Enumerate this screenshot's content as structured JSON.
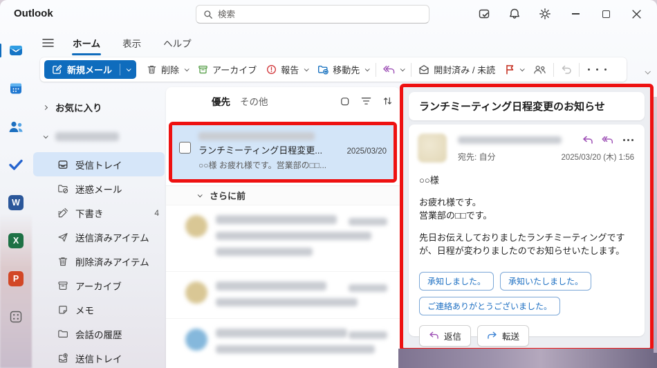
{
  "colors": {
    "accent": "#0f6cbd",
    "annotation_red": "#ee1111",
    "selected_mail_bg": "#d3e5f8",
    "folder_selected_bg": "#d6e6f9"
  },
  "titlebar": {
    "app_name": "Outlook",
    "search_placeholder": "検索"
  },
  "ribbon": {
    "tabs": [
      {
        "label": "ホーム"
      },
      {
        "label": "表示"
      },
      {
        "label": "ヘルプ"
      }
    ]
  },
  "toolbar": {
    "new_mail_label": "新規メール",
    "delete_label": "削除",
    "archive_label": "アーカイブ",
    "report_label": "報告",
    "move_to_label": "移動先",
    "read_unread_label": "開封済み / 未読"
  },
  "appbar": {
    "items": [
      {
        "name": "mail"
      },
      {
        "name": "calendar"
      },
      {
        "name": "people"
      },
      {
        "name": "todo"
      },
      {
        "name": "word",
        "letter": "W"
      },
      {
        "name": "excel",
        "letter": "X"
      },
      {
        "name": "powerpoint",
        "letter": "P"
      },
      {
        "name": "apps"
      }
    ]
  },
  "folder_pane": {
    "favorites_label": "お気に入り",
    "folders": [
      {
        "label": "受信トレイ",
        "icon": "inbox-icon",
        "selected": true
      },
      {
        "label": "迷惑メール",
        "icon": "junk-folder-icon"
      },
      {
        "label": "下書き",
        "icon": "drafts-pencil-icon",
        "count": "4"
      },
      {
        "label": "送信済みアイテム",
        "icon": "sent-plane-icon"
      },
      {
        "label": "削除済みアイテム",
        "icon": "trash-icon"
      },
      {
        "label": "アーカイブ",
        "icon": "archive-box-icon"
      },
      {
        "label": "メモ",
        "icon": "note-icon"
      },
      {
        "label": "会話の履歴",
        "icon": "folder-icon"
      },
      {
        "label": "送信トレイ",
        "icon": "outbox-icon"
      }
    ]
  },
  "message_list": {
    "tab_focused": "優先",
    "tab_other": "その他",
    "selected_email": {
      "subject": "ランチミーティング日程変更...",
      "date": "2025/03/20",
      "preview": "○○様 お疲れ様です。営業部の□□..."
    },
    "group_header": "さらに前"
  },
  "reading_pane": {
    "subject": "ランチミーティング日程変更のお知らせ",
    "to_line": "宛先: 自分",
    "datetime": "2025/03/20 (木) 1:56",
    "body_lines": [
      "○○様",
      "お疲れ様です。",
      "営業部の□□です。",
      "先日お伝えしておりましたランチミーティングですが、日程が変わりましたのでお知らせいたします。"
    ],
    "quick_replies": [
      "承知しました。",
      "承知いたしました。",
      "ご連絡ありがとうございました。"
    ],
    "reply_label": "返信",
    "forward_label": "転送"
  }
}
